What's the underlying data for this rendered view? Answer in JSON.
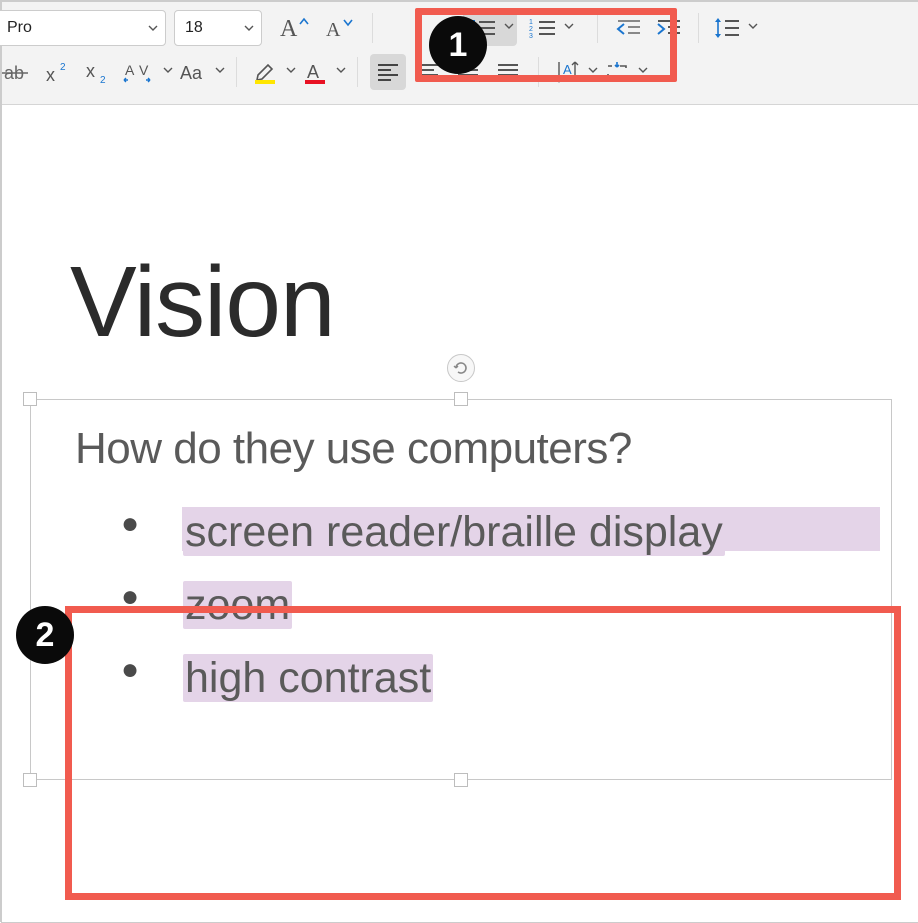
{
  "toolbar": {
    "font_name": "Pro",
    "font_size": "18",
    "increase_font": "A",
    "decrease_font": "A"
  },
  "slide": {
    "title": "Vision",
    "subheading": "How do they use computers?",
    "bullets": [
      "screen reader/braille display",
      "zoom",
      "high contrast"
    ]
  },
  "annotations": {
    "callout1": "1",
    "callout2": "2"
  },
  "colors": {
    "highlight_color": "#e4d4e8",
    "callout_border": "#f15b4f",
    "font_highlight": "#ffe600",
    "font_color_bar": "#e81123",
    "accent": "#1a75cf"
  }
}
